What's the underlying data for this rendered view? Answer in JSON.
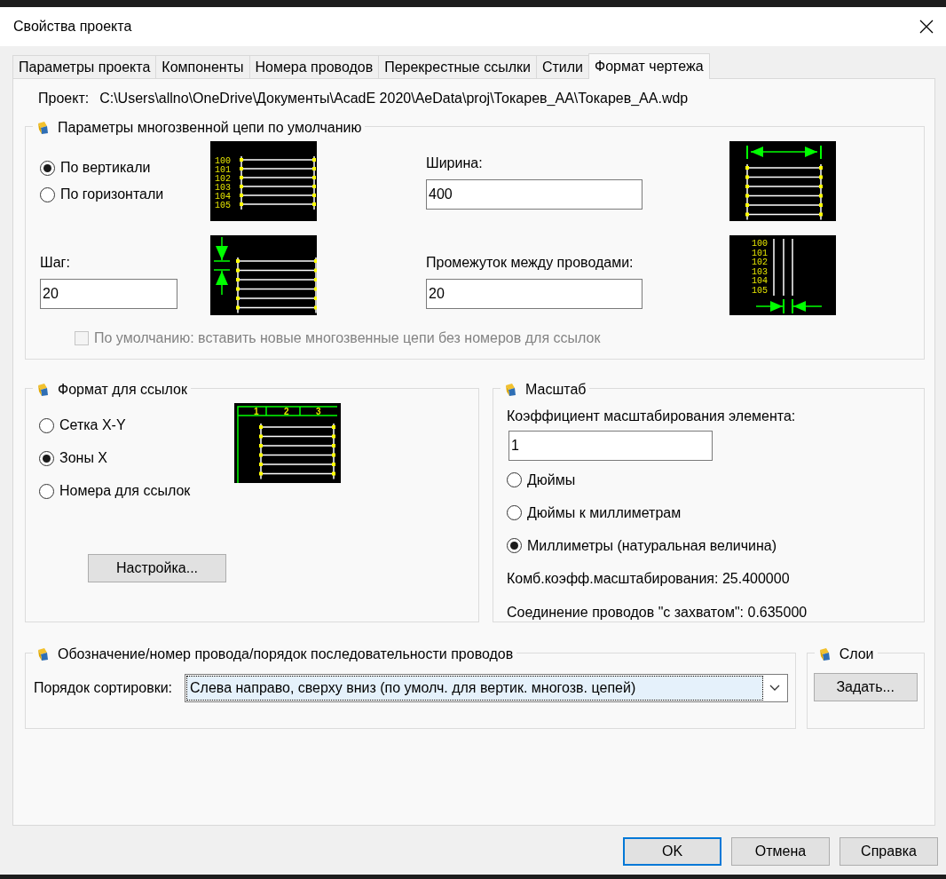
{
  "window": {
    "title": "Свойства проекта"
  },
  "tabs": [
    {
      "label": "Параметры проекта",
      "selected": false
    },
    {
      "label": "Компоненты",
      "selected": false
    },
    {
      "label": "Номера проводов",
      "selected": false
    },
    {
      "label": "Перекрестные ссылки",
      "selected": false
    },
    {
      "label": "Стили",
      "selected": false
    },
    {
      "label": "Формат чертежа",
      "selected": true
    }
  ],
  "project": {
    "label": "Проект:",
    "path": "C:\\Users\\allno\\OneDrive\\Документы\\AcadE 2020\\AeData\\proj\\Токарев_AA\\Токарев_AA.wdp"
  },
  "multiwire": {
    "title": "Параметры многозвенной цепи по умолчанию",
    "orientation_options": [
      {
        "label": "По вертикали",
        "selected": true
      },
      {
        "label": "По горизонтали",
        "selected": false
      }
    ],
    "orientation_preview": {
      "wire_numbers": [
        "100",
        "101",
        "102",
        "103",
        "104",
        "105"
      ]
    },
    "width": {
      "label": "Ширина:",
      "value": "400"
    },
    "step": {
      "label": "Шаг:",
      "value": "20"
    },
    "spacing": {
      "label": "Промежуток между проводами:",
      "value": "20"
    },
    "spacing_preview": {
      "wire_numbers": [
        "100",
        "101",
        "102",
        "103",
        "104",
        "105"
      ]
    },
    "no_reference_numbers": {
      "label": "По умолчанию: вставить новые многозвенные цепи без номеров для ссылок",
      "checked": false,
      "disabled": true
    }
  },
  "reference_format": {
    "title": "Формат для ссылок",
    "options": [
      {
        "label": "Сетка X-Y",
        "selected": false
      },
      {
        "label": "Зоны X",
        "selected": true
      },
      {
        "label": "Номера для ссылок",
        "selected": false
      }
    ],
    "preview": {
      "zone_numbers": [
        "1",
        "2",
        "3"
      ]
    },
    "setup_button": "Настройка..."
  },
  "scale": {
    "title": "Масштаб",
    "factor": {
      "label": "Коэффициент масштабирования элемента:",
      "value": "1"
    },
    "units": [
      {
        "label": "Дюймы",
        "selected": false
      },
      {
        "label": "Дюймы к миллиметрам",
        "selected": false
      },
      {
        "label": "Миллиметры (натуральная величина)",
        "selected": true
      }
    ],
    "combined_factor": "Комб.коэфф.масштабирования: 25.400000",
    "wire_gap": "Соединение проводов \"с захватом\": 0.635000"
  },
  "wire_sequence": {
    "title": "Обозначение/номер провода/порядок последовательности проводов",
    "sort_label": "Порядок сортировки:",
    "sort_value": "Слева направо, сверху вниз (по умолч. для вертик. многозв. цепей)"
  },
  "layers": {
    "title": "Слои",
    "button": "Задать..."
  },
  "buttons": [
    {
      "label": "OK",
      "default": true
    },
    {
      "label": "Отмена",
      "default": false
    },
    {
      "label": "Справка",
      "default": false
    }
  ]
}
